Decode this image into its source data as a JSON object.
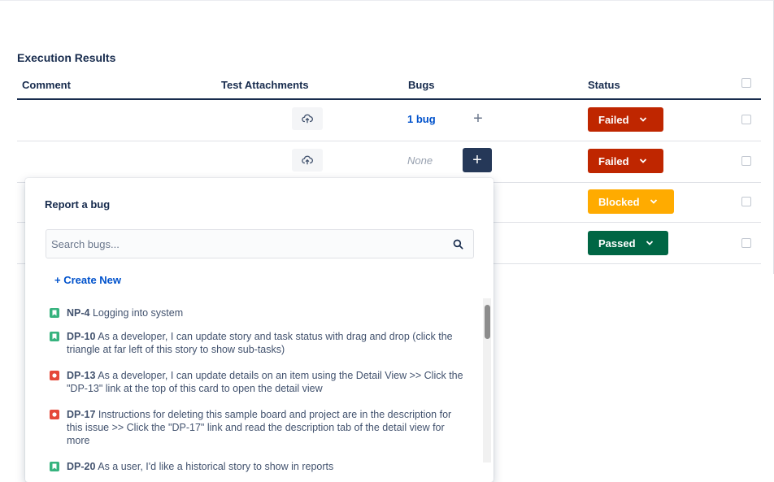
{
  "results": {
    "title": "Execution Results",
    "columns": {
      "comment": "Comment",
      "attachments": "Test Attachments",
      "bugs": "Bugs",
      "status": "Status"
    },
    "rows": [
      {
        "bugs": "1 bug",
        "status": "Failed"
      },
      {
        "bugs": "None",
        "status": "Failed"
      },
      {
        "status": "Blocked"
      },
      {
        "status": "Passed"
      }
    ]
  },
  "popup": {
    "title": "Report a bug",
    "search_placeholder": "Search bugs...",
    "create_new": "+ Create New",
    "items": [
      {
        "type": "story",
        "key": "NP-4",
        "summary": "Logging into system"
      },
      {
        "type": "story",
        "key": "DP-10",
        "summary": "As a developer, I can update story and task status with drag and drop (click the triangle at far left of this story to show sub-tasks)"
      },
      {
        "type": "bug",
        "key": "DP-13",
        "summary": "As a developer, I can update details on an item using the Detail View >> Click the \"DP-13\" link at the top of this card to open the detail view"
      },
      {
        "type": "bug",
        "key": "DP-17",
        "summary": "Instructions for deleting this sample board and project are in the description for this issue >> Click the \"DP-17\" link and read the description tab of the detail view for more"
      },
      {
        "type": "story",
        "key": "DP-20",
        "summary": "As a user, I'd like a historical story to show in reports"
      }
    ]
  },
  "colors": {
    "failed": "#bf2600",
    "blocked": "#ffab00",
    "passed": "#006644",
    "link": "#0052cc",
    "dark_button": "#253858",
    "story_icon": "#36b37e",
    "bug_icon": "#e5493a"
  },
  "icons": {
    "attachment": "cloud-upload-icon",
    "search": "search-icon",
    "chevron": "chevron-down-icon",
    "add": "plus-icon",
    "story": "story-icon",
    "bug": "bug-icon"
  }
}
